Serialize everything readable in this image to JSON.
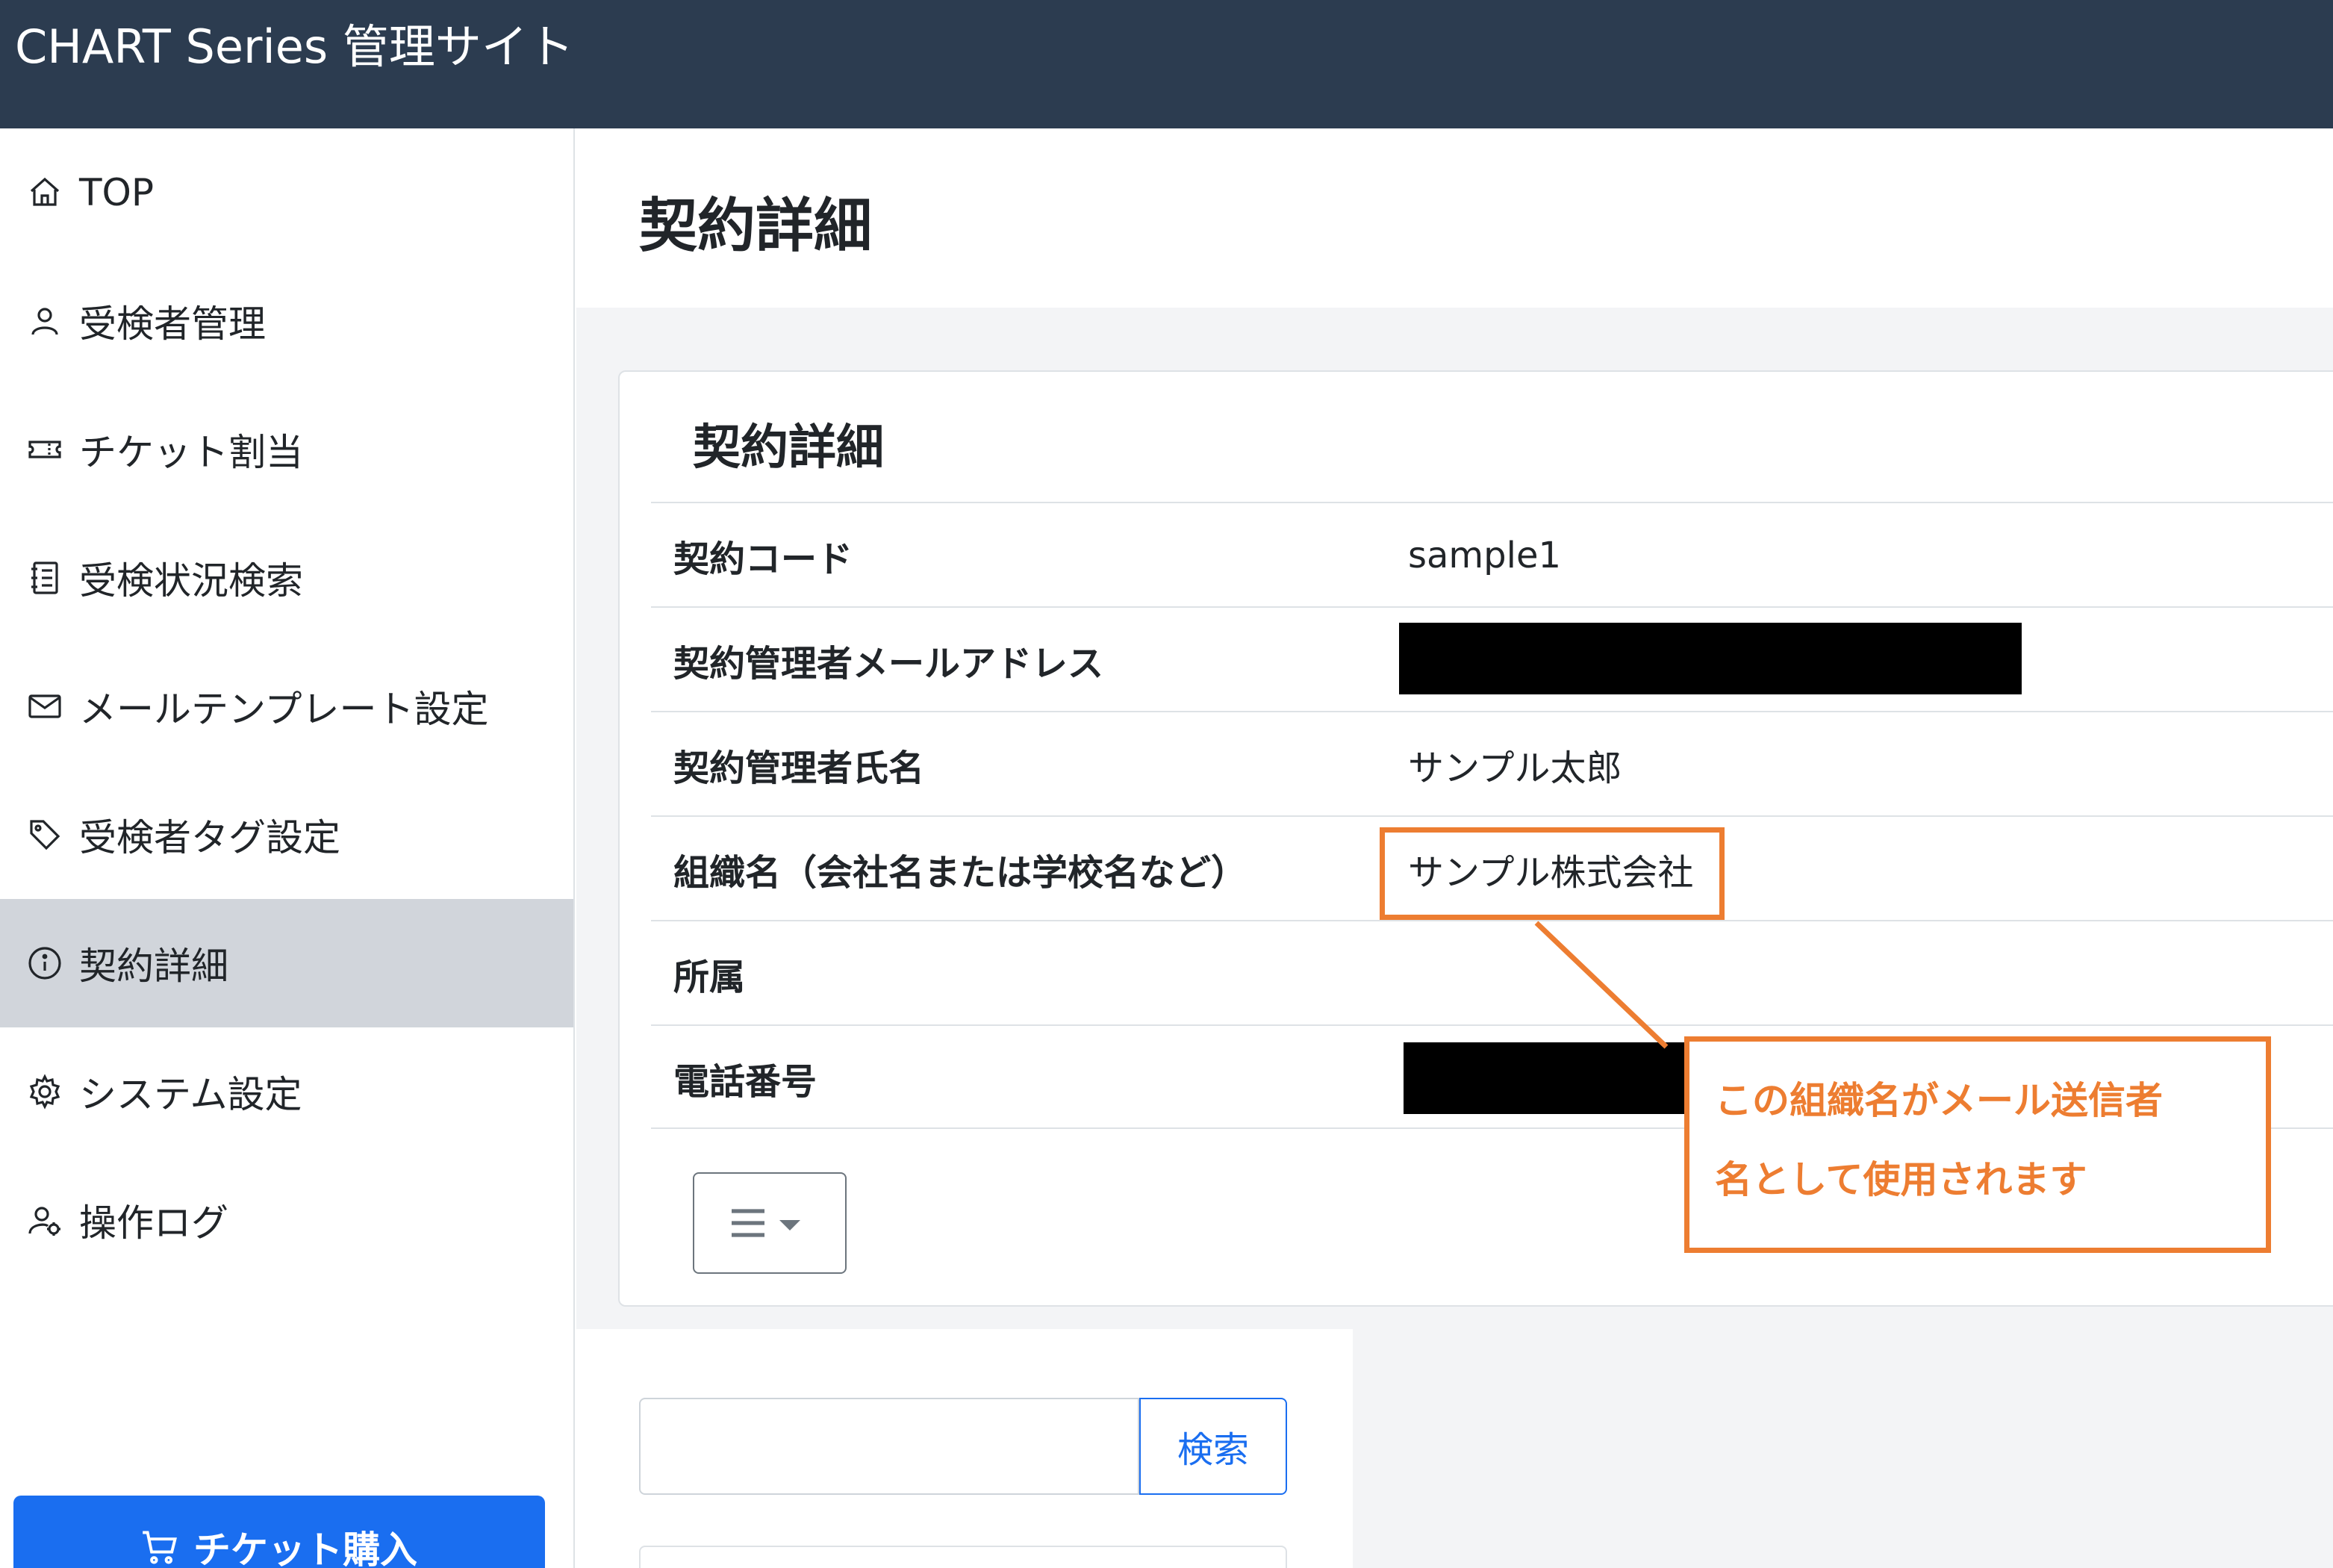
{
  "app": {
    "title": "CHART Series 管理サイト"
  },
  "sidebar": {
    "items": [
      {
        "label": "TOP",
        "icon": "home-icon"
      },
      {
        "label": "受検者管理",
        "icon": "user-icon"
      },
      {
        "label": "チケット割当",
        "icon": "ticket-icon"
      },
      {
        "label": "受検状況検索",
        "icon": "list-icon"
      },
      {
        "label": "メールテンプレート設定",
        "icon": "mail-icon"
      },
      {
        "label": "受検者タグ設定",
        "icon": "tag-icon"
      },
      {
        "label": "契約詳細",
        "icon": "info-icon",
        "active": true
      },
      {
        "label": "システム設定",
        "icon": "gear-icon"
      },
      {
        "label": "操作ログ",
        "icon": "user-gear-icon"
      }
    ],
    "buy_button": "チケット購入"
  },
  "page": {
    "title": "契約詳細"
  },
  "card": {
    "title": "契約詳細",
    "rows": [
      {
        "label": "契約コード",
        "value": "sample1"
      },
      {
        "label": "契約管理者メールアドレス",
        "value": "",
        "redacted": true
      },
      {
        "label": "契約管理者氏名",
        "value": "サンプル太郎"
      },
      {
        "label": "組織名（会社名または学校名など）",
        "value": "サンプル株式会社"
      },
      {
        "label": "所属",
        "value": ""
      },
      {
        "label": "電話番号",
        "value": "",
        "redacted": true
      }
    ]
  },
  "search": {
    "placeholder": "",
    "button": "検索"
  },
  "annotation": {
    "line1": "この組織名がメール送信者",
    "line2": "名として使用されます",
    "color": "#ed7d31"
  },
  "colors": {
    "header": "#2c3c50",
    "primary": "#1a6ef0",
    "active": "#d1d5db"
  }
}
